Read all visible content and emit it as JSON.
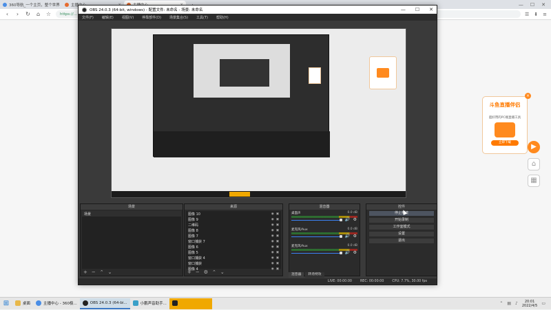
{
  "browser": {
    "tabs": [
      {
        "label": "360导航_一个主页，整个世界",
        "active": false
      },
      {
        "label": "主播中心",
        "active": false
      },
      {
        "label": "主播中心",
        "active": true
      }
    ],
    "url": "https://...",
    "new_tab": "+"
  },
  "obs": {
    "title": "OBS 24.0.3 (64-bit, windows) - 配置文件: 未命名 - 场景: 未命名",
    "menu": [
      "文件(F)",
      "编辑(E)",
      "视图(V)",
      "停靠部件(D)",
      "场景集合(S)",
      "工具(T)",
      "帮助(H)"
    ],
    "docks": {
      "scenes_title": "场景",
      "sources_title": "来源",
      "mixer_title": "混音器",
      "controls_title": "控件"
    },
    "scenes": [
      "场景"
    ],
    "sources": [
      "图像 10",
      "图像 9",
      "二维码",
      "图像 8",
      "图像 7",
      "窗口捕获 7",
      "图像 6",
      "图像 5",
      "窗口捕获 4",
      "窗口捕获",
      "图像 4"
    ],
    "mixer": [
      {
        "name": "桌面声",
        "db": "0.0 dB"
      },
      {
        "name": "麦克风/Aux",
        "db": "0.0 dB"
      },
      {
        "name": "麦克风/Aux",
        "db": "0.0 dB"
      }
    ],
    "mixer_tabs": [
      "混音器",
      "转场特效"
    ],
    "controls": [
      "停止推流",
      "开始录制",
      "工作室模式",
      "设置",
      "退出"
    ],
    "status": {
      "live": "LIVE: 00:00:00",
      "rec": "REC: 00:00:00",
      "cpu": "CPU: 7.7%, 30.00 fps"
    },
    "footer_icons": [
      "+",
      "−",
      "⌃",
      "⌄"
    ]
  },
  "ad": {
    "title": "斗鱼直播伴侣",
    "subtitle": "超好用的PC端直播工具",
    "button": "立即下载",
    "close": "×"
  },
  "taskbar": {
    "items": [
      {
        "label": "桌面",
        "active": false
      },
      {
        "label": "主播中心 - 360极...",
        "active": false
      },
      {
        "label": "OBS 24.0.3 (64-bi...",
        "active": true
      },
      {
        "label": "小鹏声音助手...",
        "active": false
      },
      {
        "label": "",
        "active": false,
        "orange": true
      }
    ],
    "time": "20:01",
    "date": "2022/4/5"
  },
  "colors": {
    "accent": "#ff7a00",
    "obs_bg": "#2b2b2b",
    "taskbar_active": "#3b78c4"
  }
}
